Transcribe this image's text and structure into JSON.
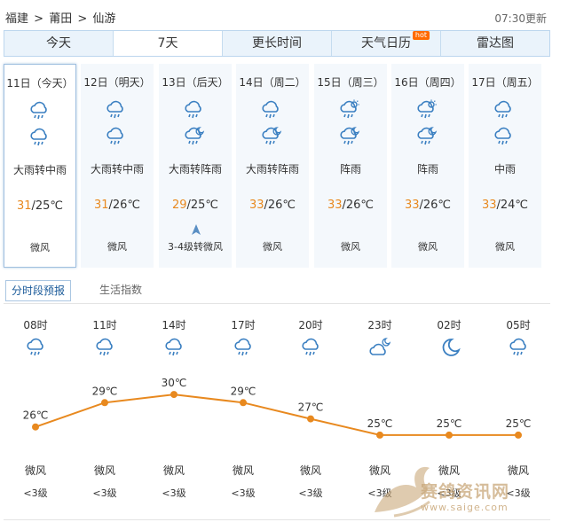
{
  "breadcrumb": [
    "福建",
    ">",
    "莆田",
    ">",
    "仙游"
  ],
  "updated": "07:30更新",
  "tabs": [
    {
      "label": "今天",
      "active": false
    },
    {
      "label": "7天",
      "active": true
    },
    {
      "label": "更长时间",
      "active": false
    },
    {
      "label": "天气日历",
      "active": false,
      "badge": "hot"
    },
    {
      "label": "雷达图",
      "active": false
    }
  ],
  "days": [
    {
      "title": "11日（今天）",
      "icon1": "rain-cloud-icon",
      "icon2": "rain-cloud-icon",
      "desc": "大雨转中雨",
      "hi": "31",
      "lo": "/25℃",
      "wind": "微风",
      "active": true
    },
    {
      "title": "12日（明天）",
      "icon1": "rain-cloud-icon",
      "icon2": "rain-cloud-icon",
      "desc": "大雨转中雨",
      "hi": "31",
      "lo": "/26℃",
      "wind": "微风",
      "active": false
    },
    {
      "title": "13日（后天）",
      "icon1": "rain-cloud-icon",
      "icon2": "shower-cloud-icon",
      "desc": "大雨转阵雨",
      "hi": "29",
      "lo": "/25℃",
      "wind": "3-4级转微风",
      "active": false,
      "wind_arrow": true
    },
    {
      "title": "14日（周二）",
      "icon1": "rain-cloud-icon",
      "icon2": "shower-cloud-icon",
      "desc": "大雨转阵雨",
      "hi": "33",
      "lo": "/26℃",
      "wind": "微风",
      "active": false
    },
    {
      "title": "15日（周三）",
      "icon1": "shower-sun-icon",
      "icon2": "shower-cloud-icon",
      "desc": "阵雨",
      "hi": "33",
      "lo": "/26℃",
      "wind": "微风",
      "active": false
    },
    {
      "title": "16日（周四）",
      "icon1": "shower-sun-icon",
      "icon2": "shower-cloud-icon",
      "desc": "阵雨",
      "hi": "33",
      "lo": "/26℃",
      "wind": "微风",
      "active": false
    },
    {
      "title": "17日（周五）",
      "icon1": "rain-cloud-icon",
      "icon2": "rain-cloud-icon",
      "desc": "中雨",
      "hi": "33",
      "lo": "/24℃",
      "wind": "微风",
      "active": false
    }
  ],
  "subtabs": {
    "active": "分时段预报",
    "other": "生活指数"
  },
  "hourly": [
    {
      "time": "08时",
      "icon": "rain-cloud-icon",
      "temp": "26℃",
      "wind": "微风",
      "level": "<3级"
    },
    {
      "time": "11时",
      "icon": "rain-cloud-icon",
      "temp": "29℃",
      "wind": "微风",
      "level": "<3级"
    },
    {
      "time": "14时",
      "icon": "rain-cloud-icon",
      "temp": "30℃",
      "wind": "微风",
      "level": "<3级"
    },
    {
      "time": "17时",
      "icon": "rain-cloud-icon",
      "temp": "29℃",
      "wind": "微风",
      "level": "<3级"
    },
    {
      "time": "20时",
      "icon": "rain-cloud-icon",
      "temp": "27℃",
      "wind": "微风",
      "level": "<3级"
    },
    {
      "time": "23时",
      "icon": "cloudy-night-icon",
      "temp": "25℃",
      "wind": "微风",
      "level": "<3级"
    },
    {
      "time": "02时",
      "icon": "moon-icon",
      "temp": "25℃",
      "wind": "微风",
      "level": "<3级"
    },
    {
      "time": "05时",
      "icon": "rain-cloud-icon",
      "temp": "25℃",
      "wind": "微风",
      "level": "<3级"
    }
  ],
  "hourly_temps": [
    26,
    29,
    30,
    29,
    27,
    25,
    25,
    25
  ],
  "watermark": {
    "text": "赛鸽资讯网",
    "url": "www.saige.com"
  },
  "colors": {
    "accent": "#e8891f",
    "icon": "#3a7fc1",
    "tab_bg": "#eaf3fb",
    "curve": "#e8891f"
  }
}
